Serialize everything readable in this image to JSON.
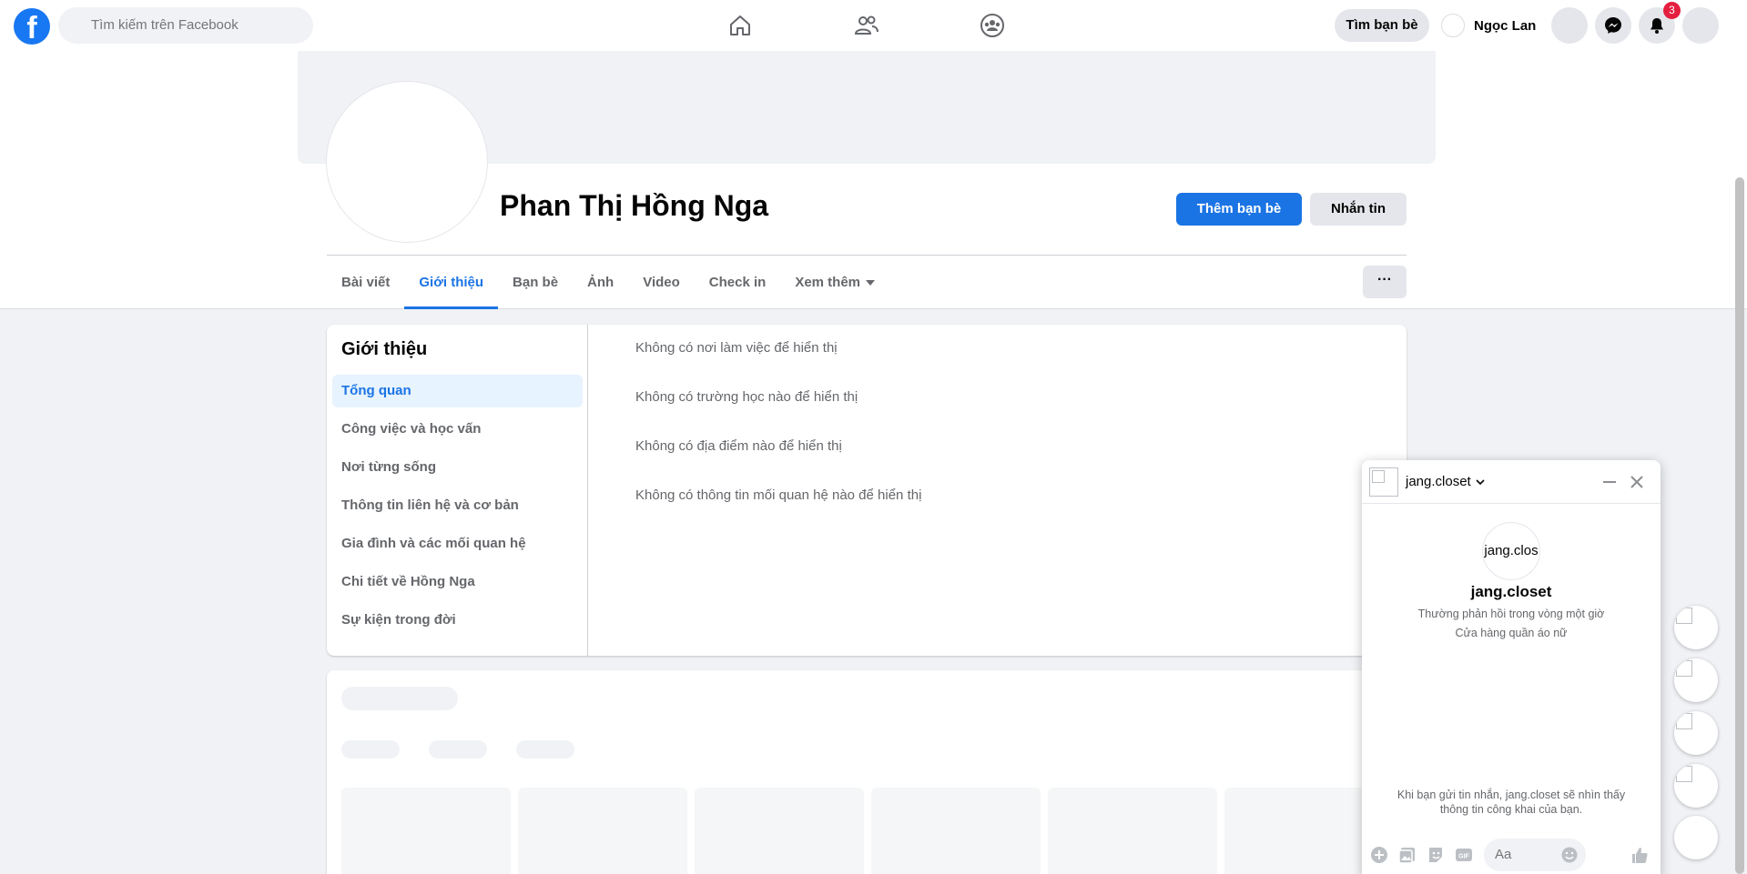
{
  "topnav": {
    "logo_text": "f",
    "search_placeholder": "Tìm kiếm trên Facebook",
    "find_friends_label": "Tìm bạn bè",
    "user_name": "Ngọc Lan",
    "notification_count": "3"
  },
  "profile": {
    "name": "Phan Thị Hồng Nga",
    "add_friend_label": "Thêm bạn bè",
    "message_label": "Nhắn tin",
    "more_label": "···",
    "tabs": [
      "Bài viết",
      "Giới thiệu",
      "Bạn bè",
      "Ảnh",
      "Video",
      "Check in",
      "Xem thêm"
    ]
  },
  "about": {
    "title": "Giới thiệu",
    "menu": [
      "Tổng quan",
      "Công việc và học vấn",
      "Nơi từng sống",
      "Thông tin liên hệ và cơ bản",
      "Gia đình và các mối quan hệ",
      "Chi tiết về Hồng Nga",
      "Sự kiện trong đời"
    ],
    "lines": [
      "Không có nơi làm việc để hiển thị",
      "Không có trường học nào để hiển thị",
      "Không có địa điểm nào để hiển thị",
      "Không có thông tin mối quan hệ nào để hiển thị"
    ]
  },
  "chat": {
    "header_name": "jang.closet",
    "avatar_alt": "jang.clos",
    "title": "jang.closet",
    "response_time": "Thường phản hồi trong vòng một giờ",
    "category": "Cửa hàng quần áo nữ",
    "privacy_note": "Khi bạn gửi tin nhắn, jang.closet sẽ nhìn thấy thông tin công khai của bạn.",
    "input_placeholder": "Aa",
    "gif_label": "GIF"
  },
  "colors": {
    "brand_blue": "#1877f2",
    "action_blue": "#1b74e4",
    "badge_red": "#e41e3f",
    "page_bg": "#f0f2f5"
  }
}
